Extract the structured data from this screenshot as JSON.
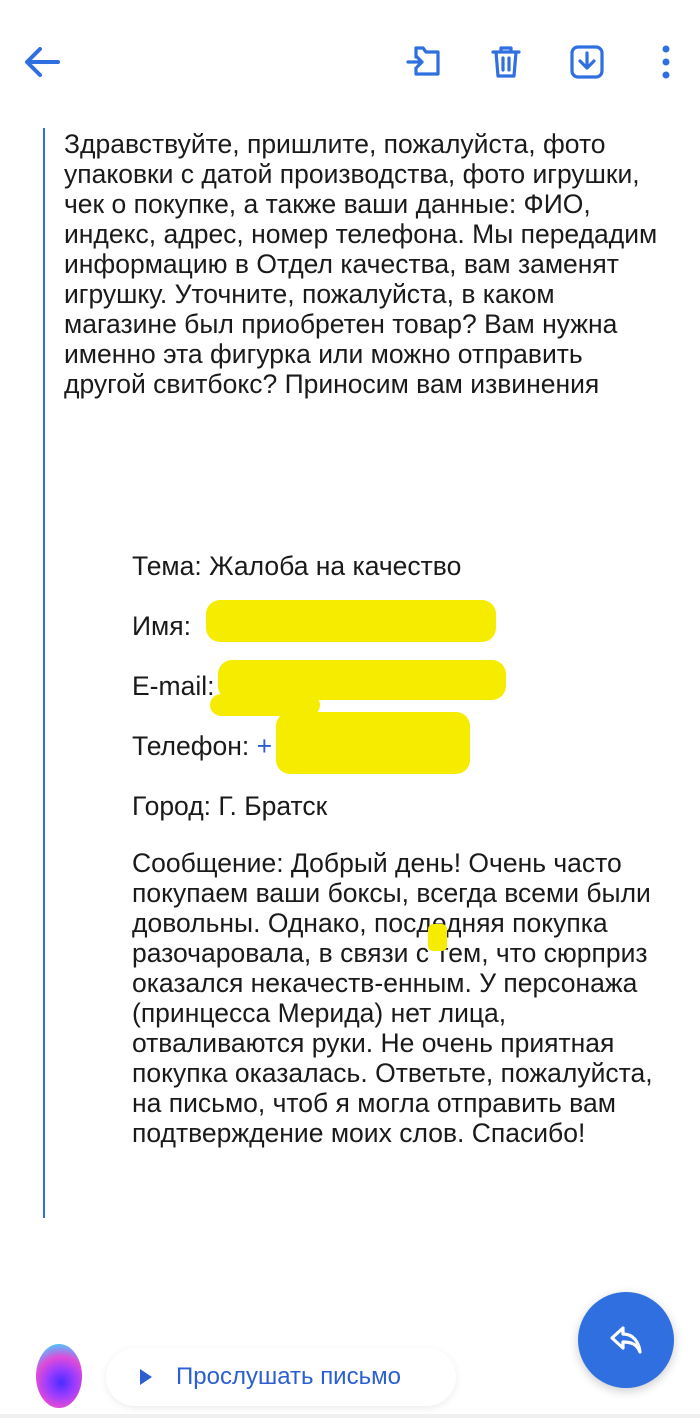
{
  "toolbar": {
    "back_icon": "arrow-left-icon",
    "move_icon": "folder-move-icon",
    "delete_icon": "trash-icon",
    "save_icon": "download-icon",
    "more_icon": "more-vertical-icon",
    "accent_color": "#2f6fe0"
  },
  "reply": {
    "text": "Здравствуйте, пришлите, пожалуйста, фото упаковки с датой производства, фото игрушки, чек о покупке, а также ваши данные: ФИО, индекс, адрес, номер телефона. Мы передадим информацию в Отдел качества, вам заменят игрушку. Уточните, пожалуйста, в каком магазине был приобретен товар? Вам нужна именно эта фигурка или можно отправить другой свитбокс? Приносим вам извинения"
  },
  "form": {
    "subject": "Тема: Жалоба на качество",
    "name_label": "Имя:",
    "email_label": "E-mail:",
    "phone_label": "Телефон:",
    "phone_prefix": "+",
    "city": "Город: Г. Братск",
    "message": "Сообщение: Добрый день! Очень часто покупаем ваши боксы, всегда всеми были довольны. Однако, посдедняя покупка разочаровала, в связи с тем, что сюрприз оказался некачеств-енным. У персонажа (принцесса Мерида) нет лица, отваливаются руки. Не очень приятная покупка оказалась. Ответьте, пожалуйста, на письмо, чтоб я могла отправить вам подтверждение моих слов. Спасибо!",
    "redaction_color": "#f5ec00"
  },
  "bottom": {
    "listen_label": "Прослушать письмо",
    "reply_icon": "reply-icon",
    "assistant_icon": "assistant-orb-icon"
  }
}
